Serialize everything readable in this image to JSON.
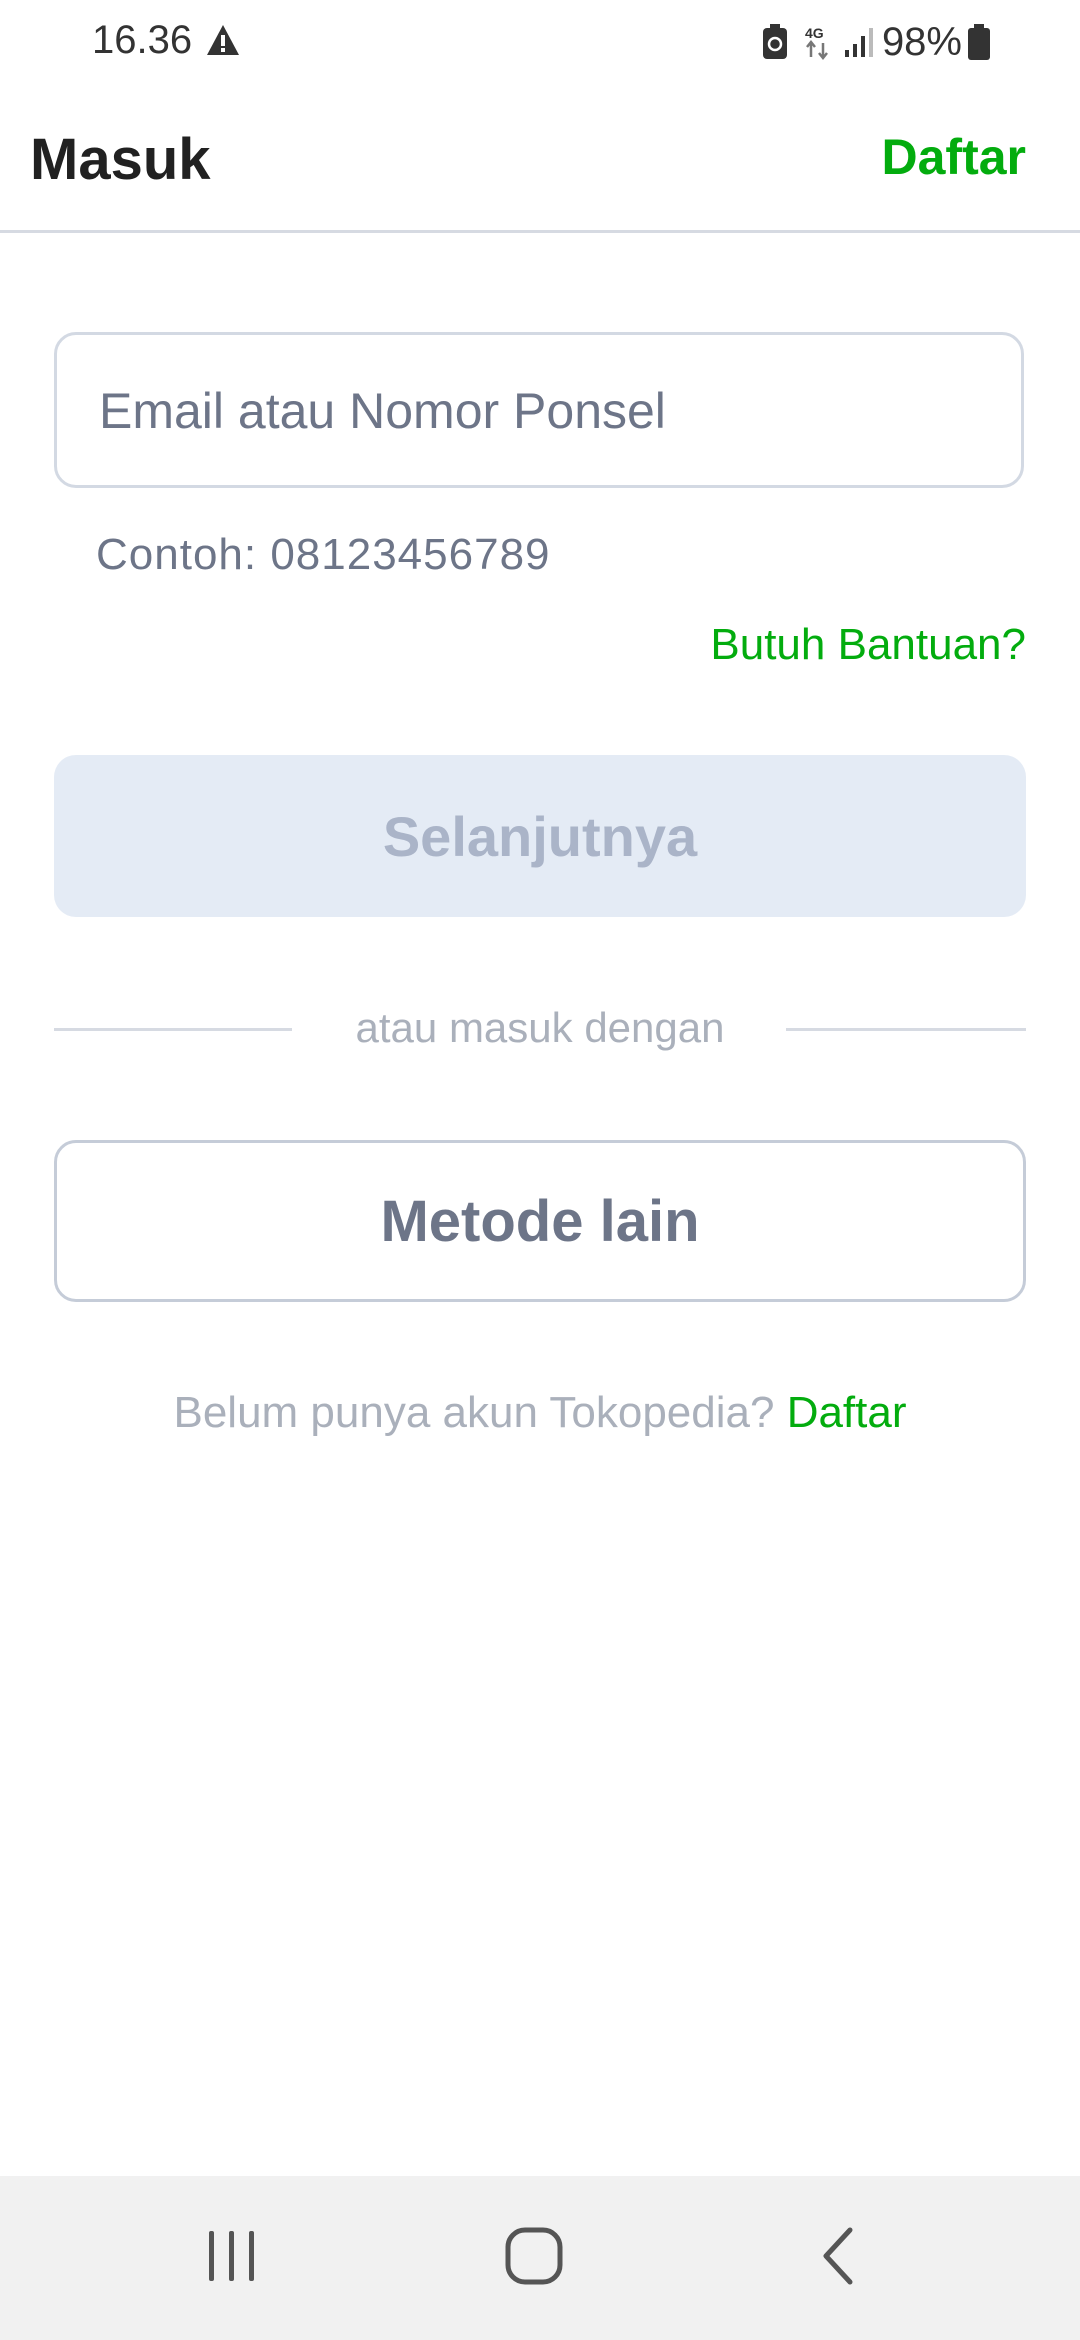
{
  "status_bar": {
    "time": "16.36",
    "battery": "98%",
    "network": "4G"
  },
  "header": {
    "title": "Masuk",
    "register_label": "Daftar"
  },
  "login_form": {
    "input_placeholder": "Email atau Nomor Ponsel",
    "input_value": "",
    "helper": "Contoh: 08123456789",
    "help_link": "Butuh Bantuan?",
    "next_label": "Selanjutnya"
  },
  "alternative": {
    "divider_text": "atau masuk dengan",
    "other_method_label": "Metode lain"
  },
  "signup": {
    "text": "Belum punya akun Tokopedia?",
    "link": "Daftar"
  },
  "colors": {
    "accent": "#03ac0e",
    "disabled_bg": "#e4ebf5",
    "disabled_text": "#aab4c8",
    "muted_text": "#6d7588"
  },
  "icons": {
    "status_warning": "warning-icon",
    "status_battery_saver": "battery-saver-icon",
    "status_signal": "signal-icon",
    "status_battery": "battery-icon",
    "nav_recents": "recents-icon",
    "nav_home": "home-icon",
    "nav_back": "back-icon"
  }
}
